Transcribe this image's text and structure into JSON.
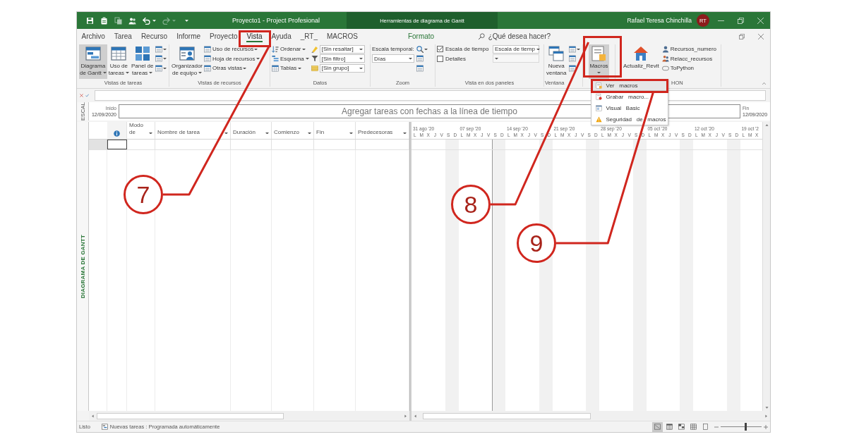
{
  "window": {
    "title": "Proyecto1 - Project Profesional",
    "context_title": "Herramientas de diagrama de Gantt",
    "user_name": "Rafael Teresa Chinchilla",
    "user_initials": "RT"
  },
  "tabs": [
    {
      "label": "Archivo",
      "kind": "tab",
      "selected": false
    },
    {
      "label": "Tarea",
      "kind": "tab",
      "selected": false
    },
    {
      "label": "Recurso",
      "kind": "tab",
      "selected": false
    },
    {
      "label": "Informe",
      "kind": "tab",
      "selected": false
    },
    {
      "label": "Proyecto",
      "kind": "tab",
      "selected": false
    },
    {
      "label": "Vista",
      "kind": "tab",
      "selected": true
    },
    {
      "label": "Ayuda",
      "kind": "tab",
      "selected": false
    },
    {
      "label": "_RT_",
      "kind": "tab",
      "selected": false
    },
    {
      "label": "MACROS",
      "kind": "tab",
      "selected": false
    },
    {
      "label": "Formato",
      "kind": "context",
      "selected": false
    }
  ],
  "search": {
    "placeholder": "¿Qué desea hacer?"
  },
  "ribbon": [
    {
      "label": "Vistas de tareas",
      "columns": [
        [
          {
            "kind": "large",
            "lines": [
              "Diagrama",
              "de Gantt"
            ],
            "dropdown": true,
            "pressed": true
          }
        ],
        [
          {
            "kind": "large",
            "lines": [
              "Uso de",
              "tareas"
            ],
            "dropdown": true,
            "pressed": false
          }
        ],
        [
          {
            "kind": "large",
            "lines": [
              "Panel de",
              "tareas"
            ],
            "dropdown": true,
            "pressed": false
          }
        ],
        [
          {
            "kind": "icon",
            "dropdown": true
          },
          {
            "kind": "icon",
            "dropdown": true
          },
          {
            "kind": "icon",
            "dropdown": true
          }
        ]
      ]
    },
    {
      "label": "Vistas de recursos",
      "columns": [
        [
          {
            "kind": "large",
            "lines": [
              "Organizador",
              "de equipo"
            ],
            "dropdown": true,
            "pressed": false
          }
        ],
        [
          {
            "kind": "small",
            "label": "Uso de recursos",
            "dropdown": true
          },
          {
            "kind": "small",
            "label": "Hoja de recursos",
            "dropdown": true
          },
          {
            "kind": "small",
            "label": "Otras vistas",
            "dropdown": true
          }
        ]
      ]
    },
    {
      "label": "Datos",
      "columns": [
        [
          {
            "kind": "small",
            "label": "Ordenar",
            "dropdown": true
          },
          {
            "kind": "small",
            "label": "Esquema",
            "dropdown": true
          },
          {
            "kind": "small",
            "label": "Tablas",
            "dropdown": true
          }
        ],
        [
          {
            "kind": "icon-select",
            "value": "[Sin resaltar]"
          },
          {
            "kind": "icon-select",
            "value": "[Sin filtro]"
          },
          {
            "kind": "icon-select",
            "value": "[Sin grupo]"
          }
        ]
      ]
    },
    {
      "label": "Zoom",
      "columns": [
        [
          {
            "kind": "text",
            "label": "Escala temporal:"
          },
          {
            "kind": "select",
            "value": "Días"
          }
        ],
        [
          {
            "kind": "icon",
            "dropdown": true
          },
          {
            "kind": "icon",
            "dropdown": false
          },
          {
            "kind": "icon",
            "dropdown": false
          }
        ]
      ]
    },
    {
      "label": "Vista en dos paneles",
      "columns": [
        [
          {
            "kind": "checkbox",
            "label": "Escala de tiempo",
            "checked": true
          },
          {
            "kind": "checkbox",
            "label": "Detalles",
            "checked": false
          }
        ],
        [
          {
            "kind": "select",
            "value": "Escala de tiemp"
          },
          {
            "kind": "select"
          }
        ]
      ]
    },
    {
      "label": "Ventana",
      "columns": [
        [
          {
            "kind": "large",
            "lines": [
              "Nueva",
              "ventana"
            ],
            "dropdown": false,
            "pressed": false
          }
        ],
        [
          {
            "kind": "icon",
            "dropdown": true
          },
          {
            "kind": "icon",
            "dropdown": false
          },
          {
            "kind": "icon",
            "dropdown": false
          }
        ]
      ]
    },
    {
      "columns": [
        [
          {
            "kind": "large",
            "lines": [
              "Macros"
            ],
            "dropdown": true,
            "pressed": true
          }
        ]
      ]
    },
    {
      "label": "HON",
      "columns": [
        [
          {
            "kind": "large",
            "lines": [
              "Actualiz_Revit"
            ],
            "dropdown": false,
            "pressed": false
          }
        ],
        [
          {
            "kind": "small",
            "label": "Recursos_numero",
            "dropdown": false
          },
          {
            "kind": "small",
            "label": "Relacc_recursos",
            "dropdown": false
          },
          {
            "kind": "small",
            "label": "ToPython",
            "dropdown": false
          }
        ]
      ]
    }
  ],
  "macros_menu": {
    "items": [
      {
        "label": "Ver macros",
        "selected": true
      },
      {
        "label": "Grabar macro...",
        "selected": false
      },
      {
        "label": "Visual Basic",
        "selected": false
      },
      {
        "label": "Seguridad de macros",
        "selected": false
      }
    ]
  },
  "timeline": {
    "label": "ESCAL",
    "start_label": "Inicio",
    "start_date": "12/09/2020",
    "prompt": "Agregar tareas con fechas a la línea de tiempo",
    "end_label": "Fin",
    "end_date": "12/09/2020"
  },
  "view_label": "DIAGRAMA DE GANTT",
  "table": {
    "columns": [
      {
        "kind": "indicator"
      },
      {
        "kind": "field",
        "label": "Modo de"
      },
      {
        "kind": "field",
        "label": "Nombre de tarea"
      },
      {
        "kind": "field",
        "label": "Duración"
      },
      {
        "kind": "field",
        "label": "Comienzo"
      },
      {
        "kind": "field",
        "label": "Fin"
      },
      {
        "kind": "field",
        "label": "Predecesoras"
      }
    ],
    "rows": [
      {
        "selected": true
      }
    ]
  },
  "gantt": {
    "weeks": [
      {
        "label": "31 ago '20",
        "days": [
          "L",
          "M",
          "X",
          "J",
          "V",
          "S",
          "D"
        ]
      },
      {
        "label": "07 sep '20",
        "days": [
          "L",
          "M",
          "X",
          "J",
          "V",
          "S",
          "D"
        ]
      },
      {
        "label": "14 sep '20",
        "days": [
          "L",
          "M",
          "X",
          "J",
          "V",
          "S",
          "D"
        ]
      },
      {
        "label": "21 sep '20",
        "days": [
          "L",
          "M",
          "X",
          "J",
          "V",
          "S",
          "D"
        ]
      },
      {
        "label": "28 sep '20",
        "days": [
          "L",
          "M",
          "X",
          "J",
          "V",
          "S",
          "D"
        ]
      },
      {
        "label": "05 oct '20",
        "days": [
          "L",
          "M",
          "X",
          "J",
          "V",
          "S",
          "D"
        ]
      },
      {
        "label": "12 oct '20",
        "days": [
          "L",
          "M",
          "X",
          "J",
          "V",
          "S",
          "D"
        ]
      },
      {
        "label": "19 oct '2",
        "days": [
          "L",
          "M",
          "X"
        ]
      }
    ]
  },
  "status_bar": {
    "mode": "Listo",
    "new_tasks": "Nuevas tareas : Programada automáticamente",
    "views": [
      {
        "selected": true
      },
      {
        "selected": false
      },
      {
        "selected": false
      },
      {
        "selected": false
      },
      {
        "selected": false
      }
    ],
    "zoom": {
      "level": 0.62
    }
  },
  "callouts": [
    {
      "number": "7"
    },
    {
      "number": "8"
    },
    {
      "number": "9"
    }
  ]
}
